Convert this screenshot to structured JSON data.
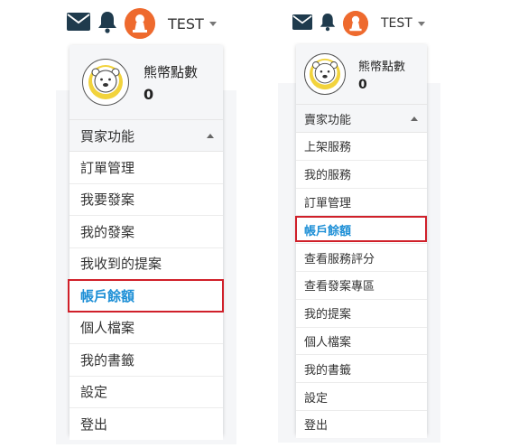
{
  "left": {
    "header": {
      "user_label": "TEST"
    },
    "profile": {
      "points_label": "熊幣點數",
      "points_value": "0"
    },
    "section": {
      "label": "買家功能"
    },
    "items": [
      {
        "label": "訂單管理"
      },
      {
        "label": "我要發案"
      },
      {
        "label": "我的發案"
      },
      {
        "label": "我收到的提案"
      },
      {
        "label": "帳戶餘額"
      },
      {
        "label": "個人檔案"
      },
      {
        "label": "我的書籤"
      },
      {
        "label": "設定"
      },
      {
        "label": "登出"
      }
    ]
  },
  "right": {
    "header": {
      "user_label": "TEST"
    },
    "profile": {
      "points_label": "熊幣點數",
      "points_value": "0"
    },
    "section": {
      "label": "賣家功能"
    },
    "items": [
      {
        "label": "上架服務"
      },
      {
        "label": "我的服務"
      },
      {
        "label": "訂單管理"
      },
      {
        "label": "帳戶餘額"
      },
      {
        "label": "查看服務評分"
      },
      {
        "label": "查看發案專區"
      },
      {
        "label": "我的提案"
      },
      {
        "label": "個人檔案"
      },
      {
        "label": "我的書籤"
      },
      {
        "label": "設定"
      },
      {
        "label": "登出"
      }
    ]
  },
  "icons": [
    "mail-icon",
    "bell-icon",
    "brand-avatar-icon",
    "bear-avatar-icon",
    "chevron-down-icon",
    "chevron-up-icon"
  ],
  "colors": {
    "icon": "#1f3b4d",
    "brand_orange": "#ee6a2e",
    "active_text": "#1d8fd6",
    "highlight_border": "#d0202a",
    "panel_bg": "#f5f6f8",
    "bear_accent": "#f2d33c"
  }
}
